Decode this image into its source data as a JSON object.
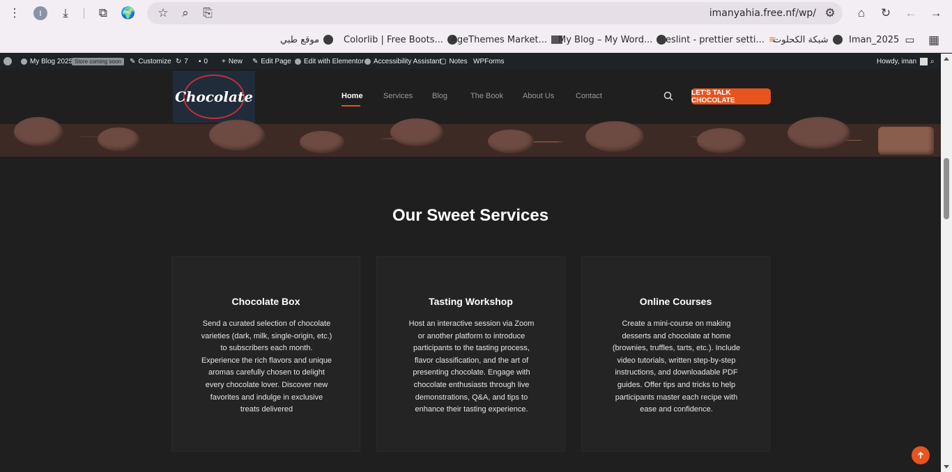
{
  "browser": {
    "profile_initial": "I",
    "url": "imanyahia.free.nf/wp/"
  },
  "bookmarks": [
    "موقع طبي",
    "Colorlib | Free Boots...",
    "AgeThemes Market...",
    "My Blog – My Word...",
    "eslint - prettier setti...",
    "شبكة الكحلوت",
    "Iman_2025"
  ],
  "adminbar": {
    "site": "My Blog 2025",
    "badge": "Store coming soon",
    "customize": "Customize",
    "updates": "7",
    "comments": "0",
    "new": "New",
    "edit_page": "Edit Page",
    "elementor": "Edit with Elementor",
    "accessibility": "Accessibility Assistant",
    "notes": "Notes",
    "wpforms": "WPForms",
    "howdy": "Howdy, iman"
  },
  "header": {
    "logo_text": "Chocolate",
    "nav": [
      "Home",
      "Services",
      "Blog",
      "The Book",
      "About Us",
      "Contact"
    ],
    "cta": "LET'S TALK CHOCOLATE"
  },
  "section": {
    "title": "Our Sweet Services",
    "cards": [
      {
        "title": "Chocolate Box",
        "text": "Send a curated selection of chocolate varieties (dark, milk, single-origin, etc.) to subscribers each month. Experience the rich flavors and unique aromas carefully chosen to delight every chocolate lover. Discover new favorites and indulge in exclusive treats delivered"
      },
      {
        "title": "Tasting Workshop",
        "text": "Host an interactive session via Zoom or another platform to introduce participants to the tasting process, flavor classification, and the art of presenting chocolate. Engage with chocolate enthusiasts through live demonstrations, Q&A, and tips to enhance their tasting experience."
      },
      {
        "title": "Online Courses",
        "text": "Create a mini-course on making desserts and chocolate at home (brownies, truffles, tarts, etc.). Include video tutorials, written step-by-step instructions, and downloadable PDF guides. Offer tips and tricks to help participants master each recipe with ease and confidence."
      }
    ]
  },
  "colors": {
    "accent": "#e8541e",
    "page_bg": "#1f1f1f",
    "card_bg": "#242424",
    "adminbar_bg": "#1d2327"
  }
}
